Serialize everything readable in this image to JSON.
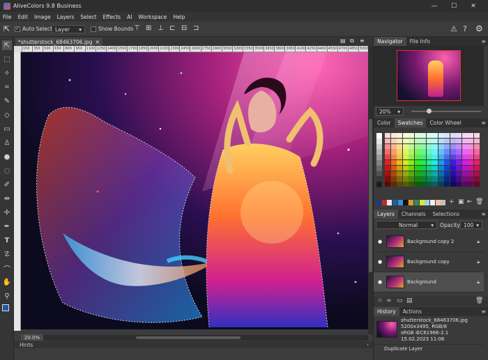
{
  "window": {
    "title": "AliveColors 9.8 Business",
    "minimize": "—",
    "maximize": "☐",
    "close": "✕"
  },
  "menu": [
    "File",
    "Edit",
    "Image",
    "Layers",
    "Select",
    "Effects",
    "AI",
    "Workspace",
    "Help"
  ],
  "options": {
    "auto_select_label": "Auto Select",
    "auto_select_checked": true,
    "layer_select_value": "Layer",
    "show_bounds_label": "Show Bounds",
    "show_bounds_checked": false
  },
  "document": {
    "tab_label": "*shutterstock_68463706.jpg",
    "ruler_top": [
      "150",
      "350",
      "500",
      "650",
      "800",
      "950",
      "1100",
      "1250",
      "1400",
      "1550",
      "1700",
      "1850",
      "2000",
      "2150",
      "2300",
      "2450",
      "2600",
      "2750",
      "2900",
      "3050",
      "3200",
      "3350",
      "3500",
      "3650",
      "3800",
      "3950",
      "4100",
      "4250",
      "4400",
      "4550",
      "4700",
      "4850",
      "5000"
    ],
    "zoom_level": "20.0%",
    "status_bar_label": "Hints"
  },
  "navigator": {
    "tabs": [
      "Navigator",
      "File Info"
    ],
    "zoom_value": "20%",
    "zoom_fraction": 0.25
  },
  "swatches_panel": {
    "tabs": [
      "Color",
      "Swatches",
      "Color Wheel"
    ],
    "custom_swatches": [
      "#1a3a8a",
      "#c62828",
      "#e8e8e8",
      "#1b5ea8",
      "#3d8fd6",
      "#111111",
      "#d6a020",
      "#2e8b57",
      "#e0e040",
      "#a0d0e0",
      "#f0f0f0",
      "#f4c0a0",
      "#c0c0c0"
    ]
  },
  "layers_panel": {
    "tabs": [
      "Layers",
      "Channels",
      "Selections"
    ],
    "blend_mode": "Normal",
    "opacity_label": "Opacity:",
    "opacity_value": "100",
    "layers": [
      {
        "name": "Background copy 2",
        "selected": false
      },
      {
        "name": "Background copy",
        "selected": false
      },
      {
        "name": "Background",
        "selected": true
      }
    ]
  },
  "history_panel": {
    "tabs": [
      "History",
      "Actions"
    ],
    "file_name": "shutterstock_68463706.jpg",
    "dimensions": "5200x3495, RGB/8",
    "color_profile": "sRGB IEC61966-2.1",
    "date": "15.02.2023 11:06",
    "steps": [
      "Duplicate Layer"
    ]
  },
  "colors": {
    "accent_blue": "#1f6fd1",
    "foreground_color": "#1f57a8",
    "background_color": "#ffffff"
  }
}
